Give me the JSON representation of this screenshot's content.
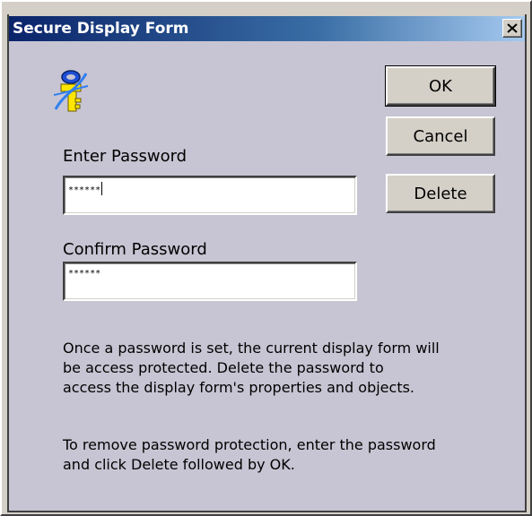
{
  "window": {
    "title": "Secure Display Form",
    "close_glyph": "✕"
  },
  "form": {
    "enter_password_label": "Enter Password",
    "enter_password_value": "******",
    "confirm_password_label": "Confirm Password",
    "confirm_password_value": "******"
  },
  "buttons": {
    "ok": "OK",
    "cancel": "Cancel",
    "delete": "Delete"
  },
  "help": {
    "paragraph1": [
      "Once a password is set, the current display form will",
      "be access protected.  Delete the password to",
      "access the display form's properties and objects."
    ],
    "paragraph2": [
      "To remove password protection, enter the password",
      "and click Delete followed by OK."
    ]
  },
  "icons": {
    "key": "key-icon",
    "close": "close-icon"
  },
  "colors": {
    "title_gradient_start": "#0a246a",
    "title_gradient_end": "#a6caf0",
    "client_background": "#c7c5d3",
    "window_background": "#d4d0c8"
  }
}
